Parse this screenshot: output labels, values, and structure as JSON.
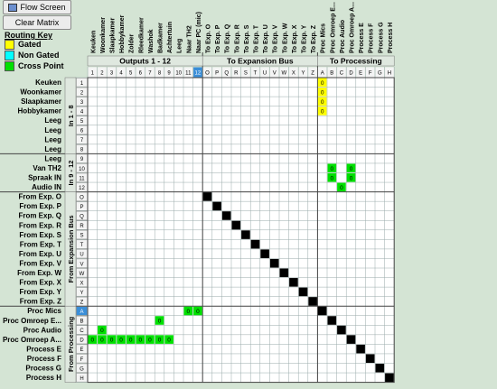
{
  "toolbar": {
    "flow_screen": "Flow Screen",
    "clear_matrix": "Clear Matrix"
  },
  "legend": {
    "title": "Routing Key",
    "items": [
      {
        "label": "Gated",
        "color": "#ffff00"
      },
      {
        "label": "Non Gated",
        "color": "#00ffff"
      },
      {
        "label": "Cross Point",
        "color": "#00e000"
      }
    ]
  },
  "colors": {
    "background": "#d4e4d4",
    "grid_bg": "#ffffff",
    "cross_point": "#00e000",
    "gated": "#ffff00",
    "selected_blue": "#3a8ed8",
    "diagonal_black": "#000000"
  },
  "matrix": {
    "output_groups": [
      "Outputs 1 - 12",
      "To Expansion Bus",
      "To Processing"
    ],
    "input_groups": [
      "In 1 - 8",
      "In 9 - 12",
      "From Expansion Bus",
      "From Processing"
    ],
    "columns": [
      {
        "label": "Keuken",
        "id": "1"
      },
      {
        "label": "Woonkamer",
        "id": "2"
      },
      {
        "label": "Slaapkamer",
        "id": "3"
      },
      {
        "label": "Hobbykamer",
        "id": "4"
      },
      {
        "label": "Zolder",
        "id": "5"
      },
      {
        "label": "Rleedkamer",
        "id": "6"
      },
      {
        "label": "Washok",
        "id": "7"
      },
      {
        "label": "Badkamer",
        "id": "8"
      },
      {
        "label": "Achtertuin",
        "id": "9"
      },
      {
        "label": "Leeg",
        "id": "10"
      },
      {
        "label": "Naar TH2",
        "id": "11"
      },
      {
        "label": "Naar PC (mic)",
        "id": "12"
      },
      {
        "label": "To Exp. O",
        "id": "O"
      },
      {
        "label": "To Exp. P",
        "id": "P"
      },
      {
        "label": "To Exp. Q",
        "id": "Q"
      },
      {
        "label": "To Exp. R",
        "id": "R"
      },
      {
        "label": "To Exp. S",
        "id": "S"
      },
      {
        "label": "To Exp. T",
        "id": "T"
      },
      {
        "label": "To Exp. U",
        "id": "U"
      },
      {
        "label": "To Exp. V",
        "id": "V"
      },
      {
        "label": "To Exp. W",
        "id": "W"
      },
      {
        "label": "To Exp. X",
        "id": "X"
      },
      {
        "label": "To Exp. Y",
        "id": "Y"
      },
      {
        "label": "To Exp. Z",
        "id": "Z"
      },
      {
        "label": "Proc Mics",
        "id": "A"
      },
      {
        "label": "Proc Omroep E...",
        "id": "B"
      },
      {
        "label": "Proc Audio",
        "id": "C"
      },
      {
        "label": "Proc Omroep A...",
        "id": "D"
      },
      {
        "label": "Process E",
        "id": "E"
      },
      {
        "label": "Process F",
        "id": "F"
      },
      {
        "label": "Process G",
        "id": "G"
      },
      {
        "label": "Process H",
        "id": "H"
      }
    ],
    "rows": [
      {
        "label": "Keuken",
        "id": "1"
      },
      {
        "label": "Woonkamer",
        "id": "2"
      },
      {
        "label": "Slaapkamer",
        "id": "3"
      },
      {
        "label": "Hobbykamer",
        "id": "4"
      },
      {
        "label": "Leeg",
        "id": "5"
      },
      {
        "label": "Leeg",
        "id": "6"
      },
      {
        "label": "Leeg",
        "id": "7"
      },
      {
        "label": "Leeg",
        "id": "8"
      },
      {
        "label": "Leeg",
        "id": "9"
      },
      {
        "label": "Van TH2",
        "id": "10"
      },
      {
        "label": "Spraak IN",
        "id": "11"
      },
      {
        "label": "Audio IN",
        "id": "12"
      },
      {
        "label": "From Exp. O",
        "id": "O"
      },
      {
        "label": "From Exp. P",
        "id": "P"
      },
      {
        "label": "From Exp. Q",
        "id": "Q"
      },
      {
        "label": "From Exp. R",
        "id": "R"
      },
      {
        "label": "From Exp. S",
        "id": "S"
      },
      {
        "label": "From Exp. T",
        "id": "T"
      },
      {
        "label": "From Exp. U",
        "id": "U"
      },
      {
        "label": "From Exp. V",
        "id": "V"
      },
      {
        "label": "From Exp. W",
        "id": "W"
      },
      {
        "label": "From Exp. X",
        "id": "X"
      },
      {
        "label": "From Exp. Y",
        "id": "Y"
      },
      {
        "label": "From Exp. Z",
        "id": "Z"
      },
      {
        "label": "Proc Mics",
        "id": "A"
      },
      {
        "label": "Proc Omroep E...",
        "id": "B"
      },
      {
        "label": "Proc Audio",
        "id": "C"
      },
      {
        "label": "Proc Omroep A...",
        "id": "D"
      },
      {
        "label": "Process E",
        "id": "E"
      },
      {
        "label": "Process F",
        "id": "F"
      },
      {
        "label": "Process G",
        "id": "G"
      },
      {
        "label": "Process H",
        "id": "H"
      }
    ],
    "selected_column": "12",
    "selected_row": "A",
    "crosspoints": [
      {
        "row": "1",
        "col": "A",
        "kind": "gated",
        "text": "0"
      },
      {
        "row": "2",
        "col": "A",
        "kind": "gated",
        "text": "0"
      },
      {
        "row": "3",
        "col": "A",
        "kind": "gated",
        "text": "0"
      },
      {
        "row": "4",
        "col": "A",
        "kind": "gated",
        "text": "0"
      },
      {
        "row": "10",
        "col": "B",
        "kind": "cross",
        "text": "0"
      },
      {
        "row": "10",
        "col": "D",
        "kind": "cross",
        "text": "0"
      },
      {
        "row": "11",
        "col": "B",
        "kind": "cross",
        "text": "0"
      },
      {
        "row": "11",
        "col": "D",
        "kind": "cross",
        "text": "0"
      },
      {
        "row": "12",
        "col": "C",
        "kind": "cross",
        "text": "0"
      },
      {
        "row": "A",
        "col": "11",
        "kind": "cross",
        "text": "0"
      },
      {
        "row": "A",
        "col": "12",
        "kind": "cross",
        "text": "0"
      },
      {
        "row": "B",
        "col": "8",
        "kind": "cross",
        "text": "0"
      },
      {
        "row": "C",
        "col": "2",
        "kind": "cross",
        "text": "0"
      },
      {
        "row": "D",
        "col": "1",
        "kind": "cross",
        "text": "0"
      },
      {
        "row": "D",
        "col": "2",
        "kind": "cross",
        "text": "0"
      },
      {
        "row": "D",
        "col": "3",
        "kind": "cross",
        "text": "0"
      },
      {
        "row": "D",
        "col": "4",
        "kind": "cross",
        "text": "0"
      },
      {
        "row": "D",
        "col": "5",
        "kind": "cross",
        "text": "0"
      },
      {
        "row": "D",
        "col": "6",
        "kind": "cross",
        "text": "0"
      },
      {
        "row": "D",
        "col": "7",
        "kind": "cross",
        "text": "0"
      },
      {
        "row": "D",
        "col": "8",
        "kind": "cross",
        "text": "0"
      },
      {
        "row": "D",
        "col": "9",
        "kind": "cross",
        "text": "0"
      },
      {
        "row": "O",
        "col": "O",
        "kind": "disabled",
        "text": ""
      },
      {
        "row": "P",
        "col": "P",
        "kind": "disabled",
        "text": ""
      },
      {
        "row": "Q",
        "col": "Q",
        "kind": "disabled",
        "text": ""
      },
      {
        "row": "R",
        "col": "R",
        "kind": "disabled",
        "text": ""
      },
      {
        "row": "S",
        "col": "S",
        "kind": "disabled",
        "text": ""
      },
      {
        "row": "T",
        "col": "T",
        "kind": "disabled",
        "text": ""
      },
      {
        "row": "U",
        "col": "U",
        "kind": "disabled",
        "text": ""
      },
      {
        "row": "V",
        "col": "V",
        "kind": "disabled",
        "text": ""
      },
      {
        "row": "W",
        "col": "W",
        "kind": "disabled",
        "text": ""
      },
      {
        "row": "X",
        "col": "X",
        "kind": "disabled",
        "text": ""
      },
      {
        "row": "Y",
        "col": "Y",
        "kind": "disabled",
        "text": ""
      },
      {
        "row": "Z",
        "col": "Z",
        "kind": "disabled",
        "text": ""
      },
      {
        "row": "A",
        "col": "A",
        "kind": "disabled",
        "text": ""
      },
      {
        "row": "B",
        "col": "B",
        "kind": "disabled",
        "text": ""
      },
      {
        "row": "C",
        "col": "C",
        "kind": "disabled",
        "text": ""
      },
      {
        "row": "D",
        "col": "D",
        "kind": "disabled",
        "text": ""
      },
      {
        "row": "E",
        "col": "E",
        "kind": "disabled",
        "text": ""
      },
      {
        "row": "F",
        "col": "F",
        "kind": "disabled",
        "text": ""
      },
      {
        "row": "G",
        "col": "G",
        "kind": "disabled",
        "text": ""
      },
      {
        "row": "H",
        "col": "H",
        "kind": "disabled",
        "text": ""
      }
    ]
  }
}
